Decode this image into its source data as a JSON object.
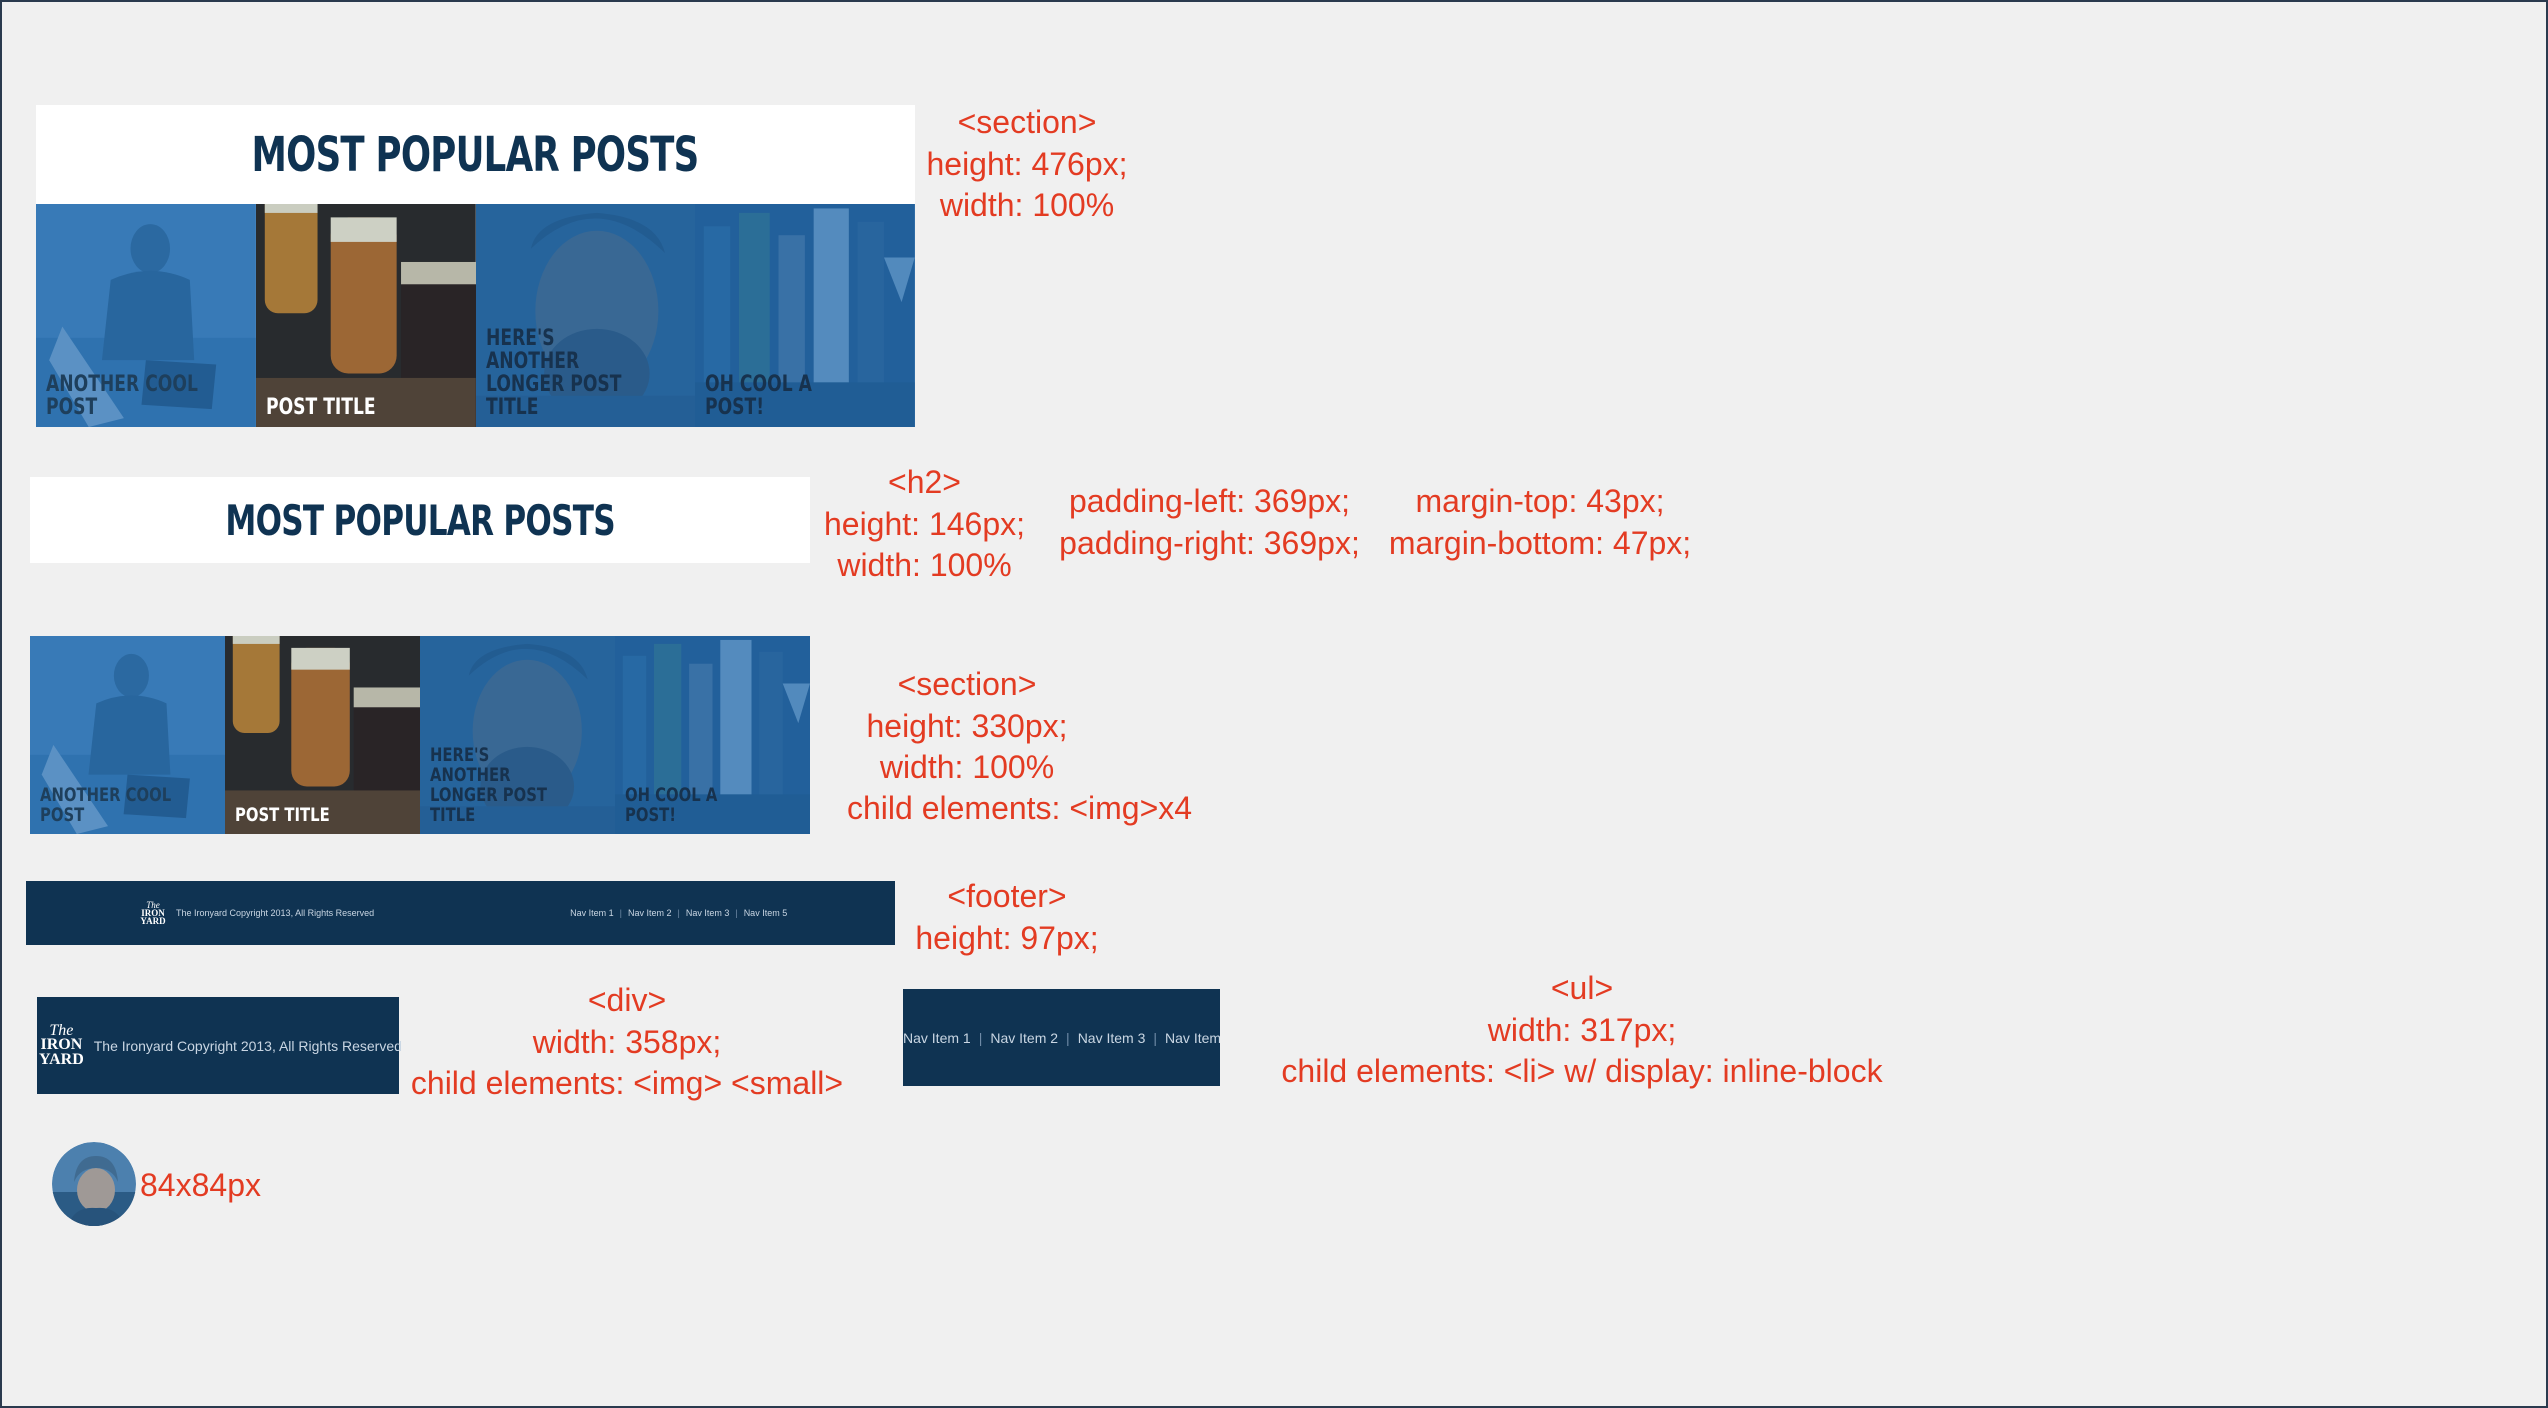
{
  "heading": {
    "title": "MOST POPULAR POSTS"
  },
  "posts": [
    {
      "label": "ANOTHER COOL POST"
    },
    {
      "label": "POST TITLE"
    },
    {
      "label": "HERE'S ANOTHER\nLONGER POST TITLE"
    },
    {
      "label": "OH COOL A POST!"
    }
  ],
  "annotations": {
    "section_full": [
      "<section>",
      "height: 476px;",
      "width: 100%"
    ],
    "h2": [
      "<h2>",
      "height: 146px;",
      "width: 100%"
    ],
    "h2_padding": [
      "padding-left: 369px;",
      "padding-right: 369px;"
    ],
    "h2_margin": [
      "margin-top: 43px;",
      "margin-bottom: 47px;"
    ],
    "section_images": [
      "<section>",
      "height: 330px;",
      "width: 100%",
      "child elements: <img>x4"
    ],
    "footer": [
      "<footer>",
      "height: 97px;"
    ],
    "div": [
      "<div>",
      "width: 358px;",
      "child elements: <img> <small>"
    ],
    "ul": [
      "<ul>",
      "width: 317px;",
      "child elements: <li> w/ display: inline-block"
    ],
    "avatar": "84x84px"
  },
  "footer": {
    "logo": {
      "line1": "The",
      "line2": "IRON",
      "line3": "YARD"
    },
    "copyright": "The Ironyard Copyright 2013, All Rights Reserved",
    "nav": [
      "Nav Item 1",
      "Nav Item 2",
      "Nav Item 3",
      "Nav Item 5"
    ],
    "separator": "|"
  },
  "colors": {
    "navy": "#0f3352",
    "annotation_red": "#e33b22",
    "tint_blue": "#246eb2",
    "background": "#f0f0f0"
  }
}
